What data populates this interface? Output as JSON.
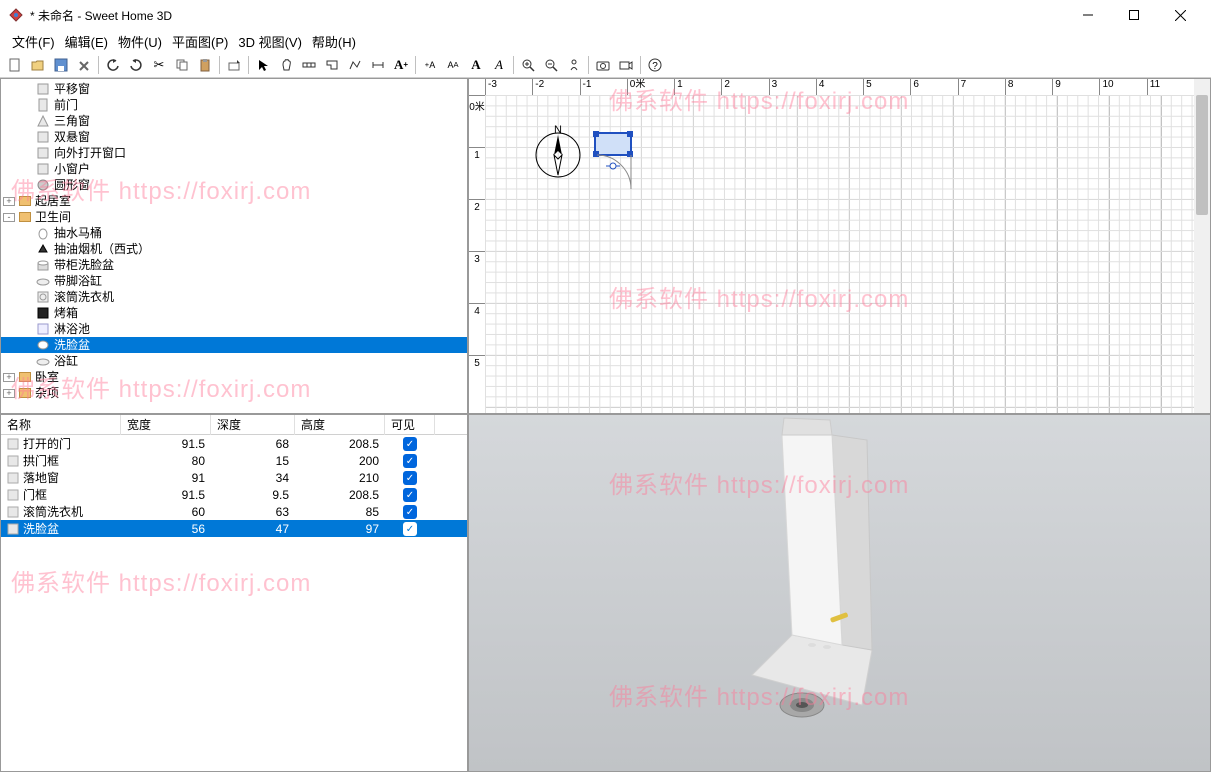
{
  "window": {
    "title": "* 未命名 - Sweet Home 3D"
  },
  "menu": {
    "file": "文件(F)",
    "edit": "编辑(E)",
    "objects": "物件(U)",
    "plan": "平面图(P)",
    "view3d": "3D 视图(V)",
    "help": "帮助(H)"
  },
  "catalog": {
    "items": [
      {
        "level": 1,
        "icon": "window",
        "label": "平移窗"
      },
      {
        "level": 1,
        "icon": "door",
        "label": "前门"
      },
      {
        "level": 1,
        "icon": "triangle",
        "label": "三角窗"
      },
      {
        "level": 1,
        "icon": "window",
        "label": "双悬窗"
      },
      {
        "level": 1,
        "icon": "window",
        "label": "向外打开窗口"
      },
      {
        "level": 1,
        "icon": "window",
        "label": "小窗户"
      },
      {
        "level": 1,
        "icon": "circle",
        "label": "圆形窗"
      }
    ],
    "folders": [
      {
        "expand": "+",
        "label": "起居室"
      },
      {
        "expand": "-",
        "label": "卫生间"
      }
    ],
    "bathItems": [
      {
        "icon": "toilet",
        "label": "抽水马桶"
      },
      {
        "icon": "hood",
        "label": "抽油烟机（西式）"
      },
      {
        "icon": "basin",
        "label": "带柜洗脸盆"
      },
      {
        "icon": "tub",
        "label": "带脚浴缸"
      },
      {
        "icon": "washer",
        "label": "滚筒洗衣机"
      },
      {
        "icon": "oven",
        "label": "烤箱"
      },
      {
        "icon": "shower",
        "label": "淋浴池"
      },
      {
        "icon": "sink",
        "label": "洗脸盆",
        "selected": true
      },
      {
        "icon": "tub",
        "label": "浴缸"
      }
    ],
    "endFolders": [
      {
        "expand": "+",
        "label": "卧室"
      },
      {
        "expand": "+",
        "label": "杂项"
      }
    ]
  },
  "table": {
    "headers": {
      "name": "名称",
      "width": "宽度",
      "depth": "深度",
      "height": "高度",
      "visible": "可见"
    },
    "rows": [
      {
        "name": "打开的门",
        "w": "91.5",
        "d": "68",
        "h": "208.5",
        "v": true
      },
      {
        "name": "拱门框",
        "w": "80",
        "d": "15",
        "h": "200",
        "v": true
      },
      {
        "name": "落地窗",
        "w": "91",
        "d": "34",
        "h": "210",
        "v": true
      },
      {
        "name": "门框",
        "w": "91.5",
        "d": "9.5",
        "h": "208.5",
        "v": true
      },
      {
        "name": "滚筒洗衣机",
        "w": "60",
        "d": "63",
        "h": "85",
        "v": true
      },
      {
        "name": "洗脸盆",
        "w": "56",
        "d": "47",
        "h": "97",
        "v": true,
        "selected": true
      }
    ]
  },
  "plan": {
    "topTicks": [
      "-3",
      "-2",
      "-1",
      "0米",
      "1",
      "2",
      "3",
      "4",
      "5",
      "6",
      "7",
      "8",
      "9",
      "10",
      "11"
    ],
    "leftTicks": [
      "0米",
      "1",
      "2",
      "3",
      "4",
      "5"
    ]
  },
  "watermark": "佛系软件 https://foxirj.com"
}
